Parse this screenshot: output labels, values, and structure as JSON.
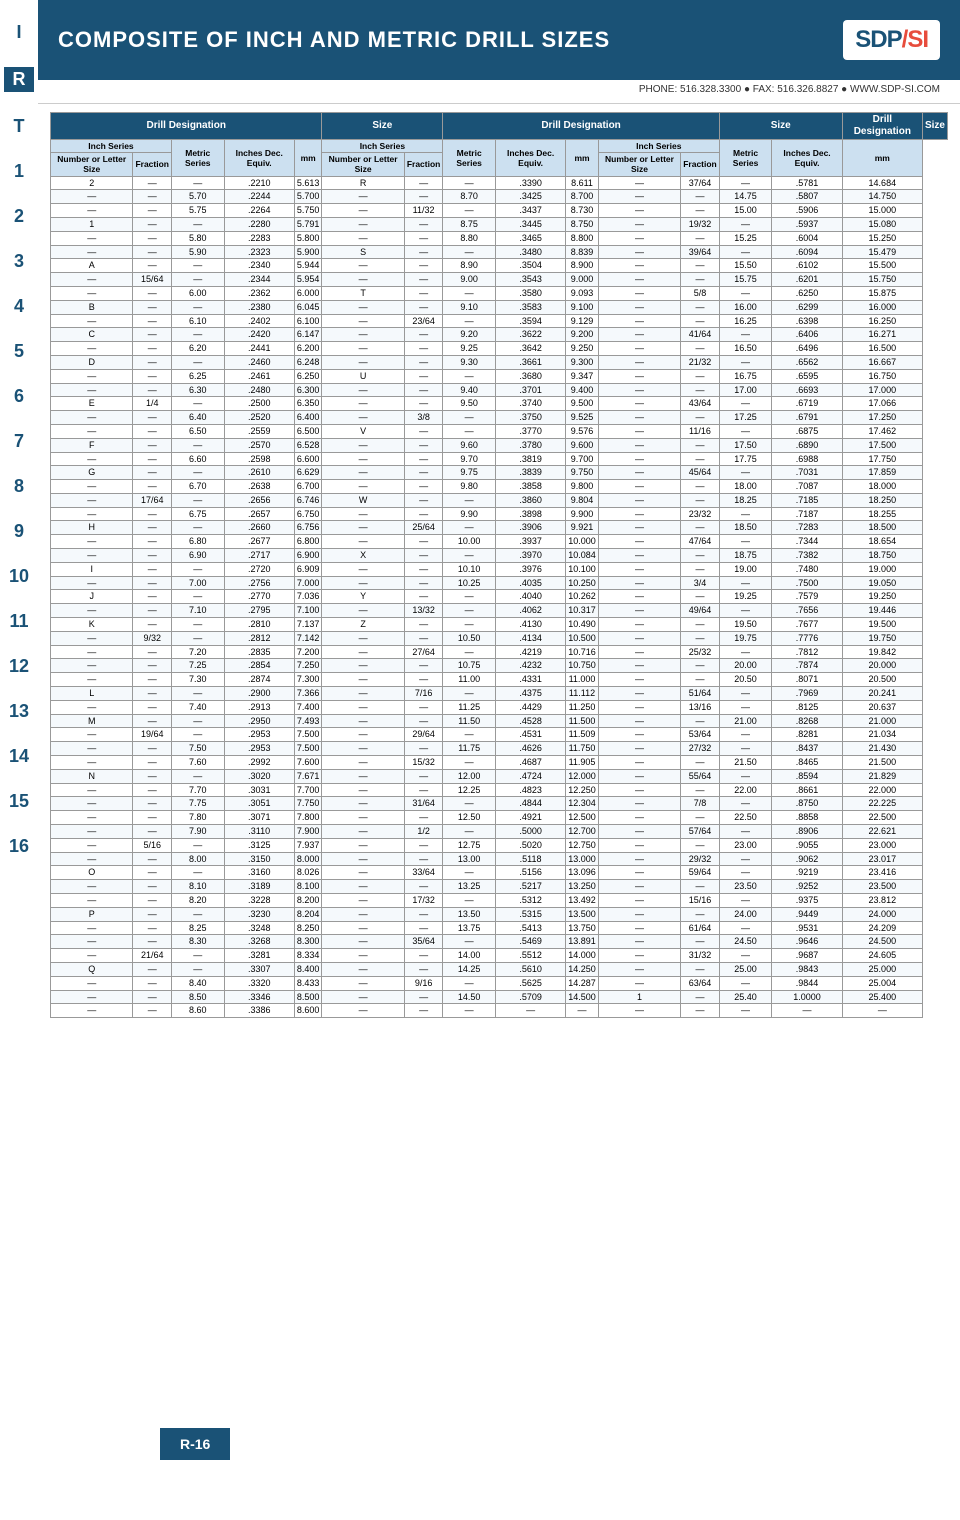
{
  "header": {
    "title": "COMPOSITE OF INCH AND METRIC DRILL SIZES",
    "logo": "SDP/SI",
    "phone": "PHONE: 516.328.3300 ● FAX: 516.326.8827 ● WWW.SDP-SI.COM"
  },
  "sidebar": {
    "letters": [
      "I",
      "R",
      "T",
      "1",
      "2",
      "3",
      "4",
      "5",
      "6",
      "7",
      "8",
      "9",
      "10",
      "11",
      "12",
      "13",
      "14",
      "15",
      "16"
    ]
  },
  "footer": {
    "label": "R-16"
  },
  "columns": {
    "group1": {
      "drill_designation": "Drill Designation",
      "inch_series": "Inch Series",
      "number_letter": "Number or Letter Size",
      "fraction": "Fraction",
      "metric_series": "Metric Series",
      "inches_dec": "Inches Dec. Equiv.",
      "mm": "mm",
      "size": "Size"
    }
  },
  "rows": [
    {
      "num": "2",
      "frac": "—",
      "metric": "—",
      "dec": ".2210",
      "mm": "5.613"
    },
    {
      "num": "—",
      "frac": "—",
      "metric": "5.70",
      "dec": ".2244",
      "mm": "5.700"
    },
    {
      "num": "—",
      "frac": "—",
      "metric": "5.75",
      "dec": ".2264",
      "mm": "5.750"
    },
    {
      "num": "1",
      "frac": "—",
      "metric": "—",
      "dec": ".2280",
      "mm": "5.791"
    },
    {
      "num": "—",
      "frac": "—",
      "metric": "5.80",
      "dec": ".2283",
      "mm": "5.800"
    },
    {
      "num": "—",
      "frac": "—",
      "metric": "5.90",
      "dec": ".2323",
      "mm": "5.900"
    },
    {
      "num": "A",
      "frac": "—",
      "metric": "—",
      "dec": ".2340",
      "mm": "5.944"
    },
    {
      "num": "—",
      "frac": "15/64",
      "metric": "—",
      "dec": ".2344",
      "mm": "5.954"
    },
    {
      "num": "—",
      "frac": "—",
      "metric": "6.00",
      "dec": ".2362",
      "mm": "6.000"
    },
    {
      "num": "B",
      "frac": "—",
      "metric": "—",
      "dec": ".2380",
      "mm": "6.045"
    }
  ]
}
